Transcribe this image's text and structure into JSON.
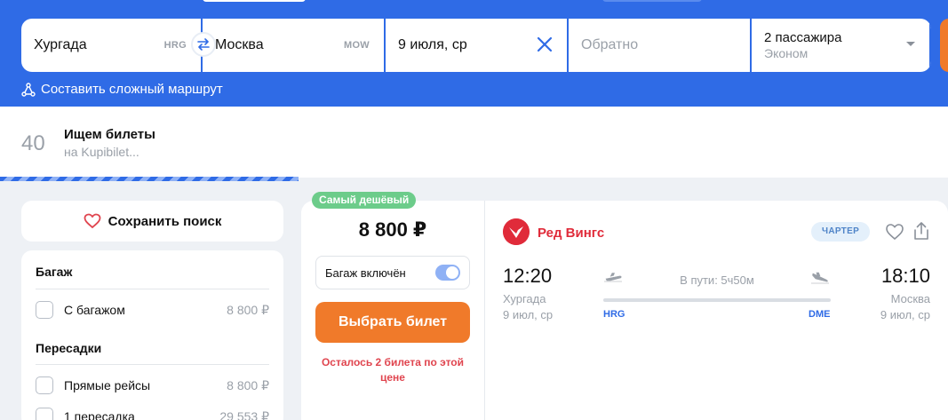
{
  "search": {
    "from": {
      "value": "Хургада",
      "code": "HRG"
    },
    "to": {
      "value": "Москва",
      "code": "MOW"
    },
    "date": {
      "value": "9 июля, ср"
    },
    "return": {
      "placeholder": "Обратно"
    },
    "passengers": {
      "count_label": "2 пассажира",
      "class_label": "Эконом"
    },
    "complex_route_label": "Составить сложный маршрут"
  },
  "status": {
    "counter": "40",
    "title": "Ищем билеты",
    "subtitle": "на Kupibilet..."
  },
  "filters": {
    "save_search_label": "Сохранить поиск",
    "baggage": {
      "heading": "Багаж",
      "items": [
        {
          "label": "С багажом",
          "price": "8 800 ₽"
        }
      ]
    },
    "transfers": {
      "heading": "Пересадки",
      "items": [
        {
          "label": "Прямые рейсы",
          "price": "8 800 ₽"
        },
        {
          "label": "1 пересадка",
          "price": "29 553 ₽"
        }
      ]
    }
  },
  "ticket": {
    "badge": "Самый дешёвый",
    "price": "8 800 ₽",
    "baggage_toggle_label": "Багаж включён",
    "baggage_included": true,
    "buy_label": "Выбрать билет",
    "note": "Осталось 2 билета по этой цене",
    "airline": "Ред Вингс",
    "charter_label": "ЧАРТЕР",
    "departure": {
      "time": "12:20",
      "city": "Хургада",
      "date": "9 июл, ср",
      "code": "HRG"
    },
    "arrival": {
      "time": "18:10",
      "city": "Москва",
      "date": "9 июл, ср",
      "code": "DME"
    },
    "duration": "В пути: 5ч50м"
  },
  "colors": {
    "brand_blue": "#2f6be6",
    "accent_orange": "#f07a2a",
    "badge_green": "#6ccc8a",
    "airline_red": "#e02b3a",
    "warning_red": "#e0454f"
  }
}
